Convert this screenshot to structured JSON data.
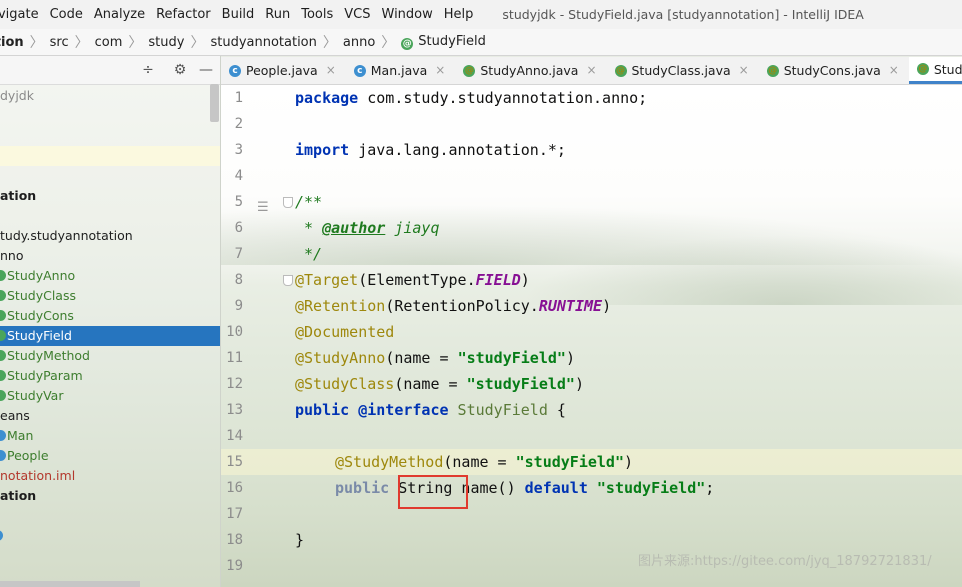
{
  "menu": {
    "items": [
      "avigate",
      "Code",
      "Analyze",
      "Refactor",
      "Build",
      "Run",
      "Tools",
      "VCS",
      "Window",
      "Help"
    ],
    "title": "studyjdk - StudyField.java [studyannotation] - IntelliJ IDEA"
  },
  "breadcrumb": [
    "ation",
    "src",
    "com",
    "study",
    "studyannotation",
    "anno",
    "StudyField"
  ],
  "project_tree": [
    {
      "label": "dyjdk",
      "indent": 0,
      "style": "muted"
    },
    {
      "label": "",
      "indent": 0
    },
    {
      "label": "",
      "indent": 0,
      "style": "highlight"
    },
    {
      "label": "",
      "indent": 0
    },
    {
      "label": "ation",
      "indent": 0,
      "style": "bold"
    },
    {
      "label": "",
      "indent": 0
    },
    {
      "label": "tudy.studyannotation",
      "indent": 0
    },
    {
      "label": "nno",
      "indent": 0
    },
    {
      "label": "StudyAnno",
      "icon": "annotation",
      "style": "green"
    },
    {
      "label": "StudyClass",
      "icon": "annotation",
      "style": "green"
    },
    {
      "label": "StudyCons",
      "icon": "annotation",
      "style": "green"
    },
    {
      "label": "StudyField",
      "icon": "annotation",
      "style": "selected"
    },
    {
      "label": "StudyMethod",
      "icon": "annotation",
      "style": "green"
    },
    {
      "label": "StudyParam",
      "icon": "annotation",
      "style": "green"
    },
    {
      "label": "StudyVar",
      "icon": "annotation",
      "style": "green"
    },
    {
      "label": "eans",
      "indent": 0
    },
    {
      "label": "Man",
      "icon": "class",
      "style": "green"
    },
    {
      "label": "People",
      "icon": "class",
      "style": "green"
    },
    {
      "label": "notation.iml",
      "style": "module"
    },
    {
      "label": "ation",
      "style": "bold"
    }
  ],
  "tabs": [
    {
      "label": "People.java",
      "icon": "class",
      "active": false
    },
    {
      "label": "Man.java",
      "icon": "class",
      "active": false
    },
    {
      "label": "StudyAnno.java",
      "icon": "annotation",
      "active": false
    },
    {
      "label": "StudyClass.java",
      "icon": "annotation",
      "active": false
    },
    {
      "label": "StudyCons.java",
      "icon": "annotation",
      "active": false
    },
    {
      "label": "StudyField.java",
      "icon": "annotation",
      "active": true
    }
  ],
  "line_numbers": [
    "1",
    "2",
    "3",
    "4",
    "5",
    "6",
    "7",
    "8",
    "9",
    "10",
    "11",
    "12",
    "13",
    "14",
    "15",
    "16",
    "17",
    "18",
    "19"
  ],
  "code": {
    "l1_kw": "package",
    "l1_rest": " com.study.studyannotation.anno;",
    "l3_kw": "import",
    "l3_rest": " java.lang.annotation.*;",
    "l5": "/**",
    "l6_star": " * ",
    "l6_tag": "@author",
    "l6_name": " jiayq",
    "l7": " */",
    "l8_ann": "@Target",
    "l8_a": "(ElementType.",
    "l8_c": "FIELD",
    "l8_b": ")",
    "l9_ann": "@Retention",
    "l9_a": "(RetentionPolicy.",
    "l9_c": "RUNTIME",
    "l9_b": ")",
    "l10_ann": "@Documented",
    "l11_ann": "@StudyAnno",
    "l11_a": "(name = ",
    "l11_s": "\"studyField\"",
    "l11_b": ")",
    "l12_ann": "@StudyClass",
    "l12_a": "(name = ",
    "l12_s": "\"studyField\"",
    "l12_b": ")",
    "l13_kw1": "public",
    "l13_kw2": " @interface",
    "l13_name": " StudyField",
    "l13_b": " {",
    "l15_ann": "@StudyMethod",
    "l15_a": "(name = ",
    "l15_s": "\"studyField\"",
    "l15_b": ")",
    "l16_kw": "public",
    "l16_type": " String",
    "l16_a": " name() ",
    "l16_kw2": "default",
    "l16_s": " \"studyField\"",
    "l16_b": ";",
    "l18": "}"
  },
  "watermark": "图片来源:https://gitee.com/jyq_18792721831/",
  "colors": {
    "selection": "#2675bf",
    "highlight_box": "#e03a2e",
    "keyword": "#0033b3",
    "string": "#067d17",
    "annotation": "#9e880d"
  }
}
